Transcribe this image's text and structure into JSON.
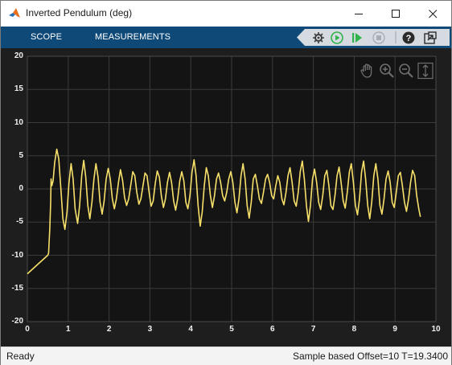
{
  "window": {
    "title": "Inverted Pendulum (deg)"
  },
  "toolstrip": {
    "tabs": [
      {
        "label": "SCOPE"
      },
      {
        "label": "MEASUREMENTS"
      }
    ]
  },
  "colors": {
    "toolstrip": "#0e4978",
    "plot_bg": "#141414",
    "axes_bg": "#1e1e1e",
    "signal": "#f7e06a",
    "grid": "#3b3b3b",
    "play": "#2fb34a"
  },
  "icons": [
    "matlab-app-icon",
    "minimize-icon",
    "maximize-icon",
    "close-icon",
    "gear-step-icon",
    "run-icon",
    "step-forward-icon",
    "stop-icon",
    "help-icon",
    "undock-icon",
    "pan-icon",
    "zoom-in-icon",
    "zoom-out-icon",
    "zoom-y-icon"
  ],
  "status": {
    "left": "Ready",
    "right": "Sample based  Offset=10  T=19.3400"
  },
  "chart_data": {
    "type": "line",
    "xlim": [
      0,
      10
    ],
    "ylim": [
      -20,
      20
    ],
    "xticks": [
      0,
      1,
      2,
      3,
      4,
      5,
      6,
      7,
      8,
      9,
      10
    ],
    "yticks": [
      20,
      15,
      10,
      5,
      0,
      -5,
      -10,
      -15,
      -20
    ],
    "grid": true,
    "series": [
      {
        "color": "#f7e06a",
        "points": [
          [
            0,
            -12.8
          ],
          [
            0.25,
            -11.4
          ],
          [
            0.5,
            -10.0
          ],
          [
            0.52,
            -9.7
          ],
          [
            0.55,
            -6.0
          ],
          [
            0.57,
            -2.0
          ],
          [
            0.58,
            1.5
          ],
          [
            0.6,
            0.5
          ],
          [
            0.63,
            1.2
          ],
          [
            0.67,
            4.0
          ],
          [
            0.72,
            6.0
          ],
          [
            0.77,
            4.5
          ],
          [
            0.82,
            0.0
          ],
          [
            0.87,
            -4.5
          ],
          [
            0.92,
            -6.1
          ],
          [
            0.97,
            -3.5
          ],
          [
            1.02,
            1.0
          ],
          [
            1.07,
            3.8
          ],
          [
            1.12,
            1.5
          ],
          [
            1.17,
            -3.0
          ],
          [
            1.23,
            -5.2
          ],
          [
            1.28,
            -2.5
          ],
          [
            1.33,
            2.0
          ],
          [
            1.38,
            4.3
          ],
          [
            1.43,
            1.8
          ],
          [
            1.48,
            -2.5
          ],
          [
            1.53,
            -4.5
          ],
          [
            1.58,
            -2.0
          ],
          [
            1.63,
            1.5
          ],
          [
            1.68,
            3.8
          ],
          [
            1.73,
            1.8
          ],
          [
            1.78,
            -2.0
          ],
          [
            1.83,
            -3.8
          ],
          [
            1.88,
            -1.8
          ],
          [
            1.93,
            1.5
          ],
          [
            1.98,
            3.1
          ],
          [
            2.03,
            1.5
          ],
          [
            2.08,
            -1.5
          ],
          [
            2.13,
            -3.0
          ],
          [
            2.18,
            -1.5
          ],
          [
            2.23,
            1.0
          ],
          [
            2.28,
            2.9
          ],
          [
            2.33,
            1.3
          ],
          [
            2.38,
            -1.3
          ],
          [
            2.43,
            -2.5
          ],
          [
            2.48,
            -1.5
          ],
          [
            2.53,
            0.5
          ],
          [
            2.58,
            2.6
          ],
          [
            2.63,
            2.0
          ],
          [
            2.68,
            -0.5
          ],
          [
            2.73,
            -2.3
          ],
          [
            2.78,
            -1.5
          ],
          [
            2.83,
            0.5
          ],
          [
            2.88,
            2.4
          ],
          [
            2.93,
            2.0
          ],
          [
            2.98,
            -0.5
          ],
          [
            3.03,
            -2.6
          ],
          [
            3.08,
            -1.8
          ],
          [
            3.13,
            0.8
          ],
          [
            3.18,
            2.7
          ],
          [
            3.23,
            1.8
          ],
          [
            3.28,
            -1.0
          ],
          [
            3.33,
            -2.8
          ],
          [
            3.38,
            -1.5
          ],
          [
            3.43,
            1.0
          ],
          [
            3.48,
            2.5
          ],
          [
            3.53,
            1.0
          ],
          [
            3.58,
            -1.8
          ],
          [
            3.63,
            -3.2
          ],
          [
            3.68,
            -1.5
          ],
          [
            3.73,
            1.2
          ],
          [
            3.78,
            2.6
          ],
          [
            3.83,
            1.2
          ],
          [
            3.88,
            -2.0
          ],
          [
            3.93,
            -3.0
          ],
          [
            3.98,
            -1.0
          ],
          [
            4.03,
            2.5
          ],
          [
            4.08,
            4.4
          ],
          [
            4.13,
            2.0
          ],
          [
            4.18,
            -2.5
          ],
          [
            4.23,
            -5.6
          ],
          [
            4.28,
            -3.5
          ],
          [
            4.33,
            0.5
          ],
          [
            4.38,
            3.2
          ],
          [
            4.43,
            2.0
          ],
          [
            4.48,
            -1.0
          ],
          [
            4.53,
            -2.8
          ],
          [
            4.58,
            -1.0
          ],
          [
            4.63,
            1.5
          ],
          [
            4.68,
            2.4
          ],
          [
            4.73,
            1.0
          ],
          [
            4.78,
            -1.0
          ],
          [
            4.83,
            -1.8
          ],
          [
            4.88,
            -0.5
          ],
          [
            4.93,
            1.5
          ],
          [
            4.98,
            2.6
          ],
          [
            5.03,
            1.0
          ],
          [
            5.08,
            -2.0
          ],
          [
            5.13,
            -3.6
          ],
          [
            5.18,
            -1.5
          ],
          [
            5.23,
            2.0
          ],
          [
            5.28,
            3.8
          ],
          [
            5.33,
            1.5
          ],
          [
            5.38,
            -2.5
          ],
          [
            5.43,
            -4.4
          ],
          [
            5.48,
            -2.0
          ],
          [
            5.53,
            1.5
          ],
          [
            5.58,
            2.2
          ],
          [
            5.63,
            0.5
          ],
          [
            5.68,
            -1.5
          ],
          [
            5.73,
            -2.2
          ],
          [
            5.78,
            -0.5
          ],
          [
            5.83,
            1.5
          ],
          [
            5.88,
            2.2
          ],
          [
            5.93,
            1.0
          ],
          [
            5.98,
            -1.0
          ],
          [
            6.03,
            -1.5
          ],
          [
            6.08,
            0.5
          ],
          [
            6.13,
            2.0
          ],
          [
            6.18,
            1.0
          ],
          [
            6.23,
            -1.5
          ],
          [
            6.28,
            -2.4
          ],
          [
            6.33,
            -0.5
          ],
          [
            6.38,
            2.0
          ],
          [
            6.43,
            3.2
          ],
          [
            6.48,
            1.0
          ],
          [
            6.53,
            -1.8
          ],
          [
            6.58,
            -2.6
          ],
          [
            6.63,
            -0.5
          ],
          [
            6.68,
            2.6
          ],
          [
            6.73,
            4.2
          ],
          [
            6.78,
            1.5
          ],
          [
            6.83,
            -2.5
          ],
          [
            6.88,
            -4.9
          ],
          [
            6.93,
            -2.5
          ],
          [
            6.98,
            1.5
          ],
          [
            7.03,
            3.0
          ],
          [
            7.08,
            1.0
          ],
          [
            7.13,
            -2.0
          ],
          [
            7.18,
            -3.1
          ],
          [
            7.23,
            -1.0
          ],
          [
            7.28,
            2.0
          ],
          [
            7.33,
            2.8
          ],
          [
            7.38,
            0.5
          ],
          [
            7.43,
            -2.5
          ],
          [
            7.48,
            -3.1
          ],
          [
            7.53,
            -1.0
          ],
          [
            7.58,
            2.0
          ],
          [
            7.63,
            3.3
          ],
          [
            7.68,
            1.0
          ],
          [
            7.73,
            -1.8
          ],
          [
            7.78,
            -2.9
          ],
          [
            7.83,
            -0.5
          ],
          [
            7.88,
            2.5
          ],
          [
            7.93,
            3.8
          ],
          [
            7.98,
            1.0
          ],
          [
            8.03,
            -2.5
          ],
          [
            8.08,
            -3.9
          ],
          [
            8.13,
            -1.5
          ],
          [
            8.18,
            2.5
          ],
          [
            8.23,
            4.2
          ],
          [
            8.28,
            1.5
          ],
          [
            8.33,
            -2.5
          ],
          [
            8.38,
            -4.5
          ],
          [
            8.43,
            -2.0
          ],
          [
            8.48,
            2.0
          ],
          [
            8.53,
            3.8
          ],
          [
            8.58,
            1.5
          ],
          [
            8.63,
            -2.5
          ],
          [
            8.68,
            -3.8
          ],
          [
            8.73,
            -1.5
          ],
          [
            8.78,
            1.5
          ],
          [
            8.83,
            2.7
          ],
          [
            8.88,
            1.0
          ],
          [
            8.93,
            -2.0
          ],
          [
            8.98,
            -2.8
          ],
          [
            9.03,
            -0.5
          ],
          [
            9.08,
            2.0
          ],
          [
            9.13,
            2.5
          ],
          [
            9.18,
            0.5
          ],
          [
            9.23,
            -2.0
          ],
          [
            9.28,
            -3.4
          ],
          [
            9.33,
            -1.5
          ],
          [
            9.38,
            1.0
          ],
          [
            9.43,
            2.8
          ],
          [
            9.48,
            2.0
          ],
          [
            9.53,
            -1.0
          ],
          [
            9.58,
            -3.0
          ],
          [
            9.62,
            -4.2
          ]
        ]
      }
    ]
  }
}
